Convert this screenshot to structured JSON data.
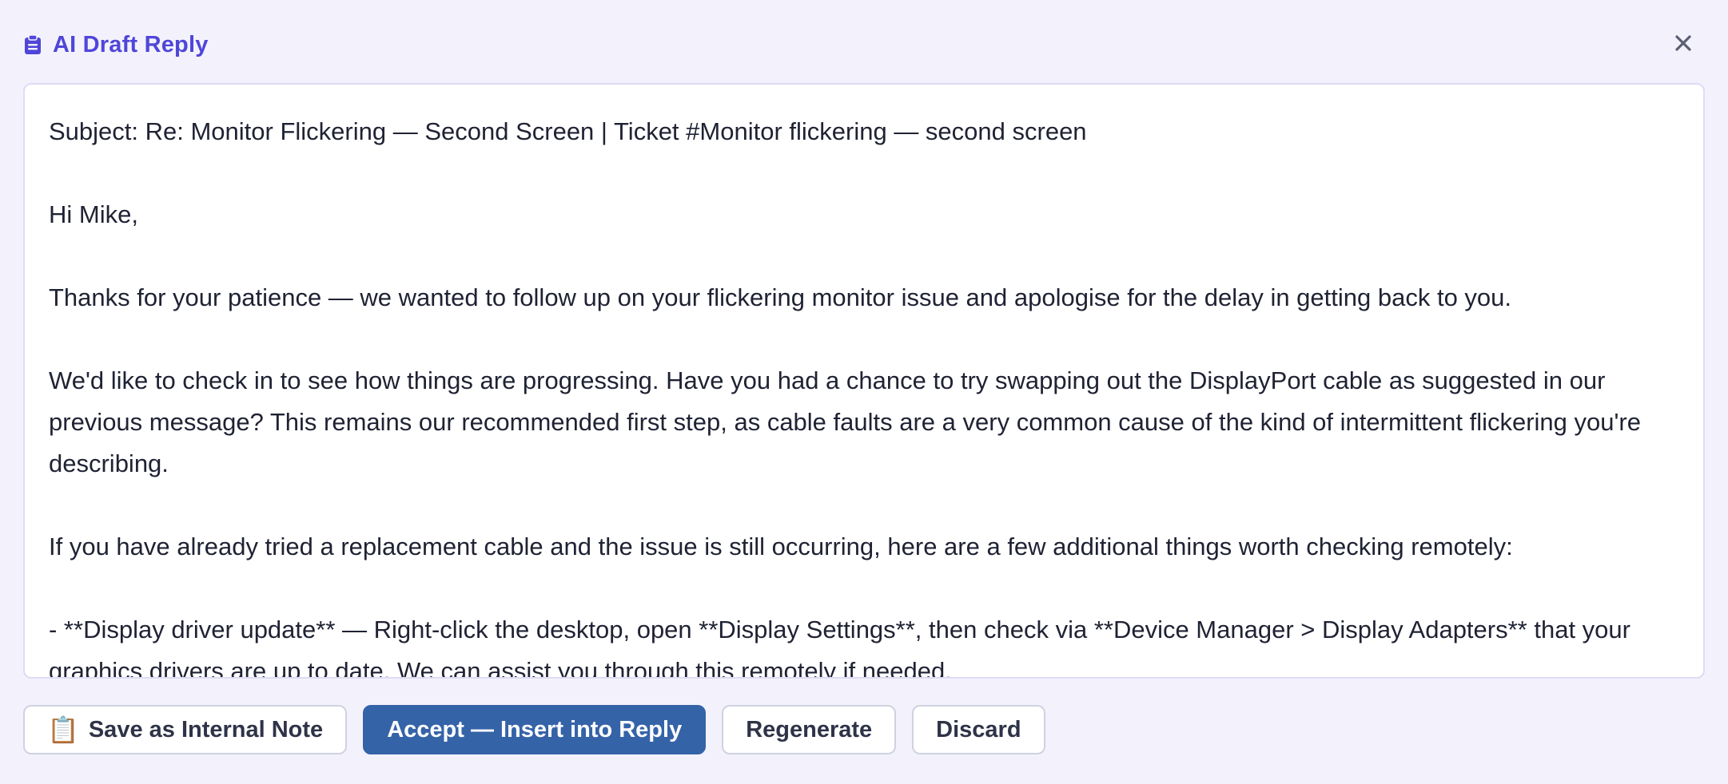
{
  "header": {
    "title": "AI Draft Reply",
    "icon": "clipboard-icon",
    "accent_color": "#4f46d8"
  },
  "close": {
    "icon": "close-icon",
    "symbol": "✕"
  },
  "draft": {
    "body": "Subject: Re: Monitor Flickering — Second Screen | Ticket #Monitor flickering — second screen\n\nHi Mike,\n\nThanks for your patience — we wanted to follow up on your flickering monitor issue and apologise for the delay in getting back to you.\n\nWe'd like to check in to see how things are progressing. Have you had a chance to try swapping out the DisplayPort cable as suggested in our previous message? This remains our recommended first step, as cable faults are a very common cause of the kind of intermittent flickering you're describing.\n\nIf you have already tried a replacement cable and the issue is still occurring, here are a few additional things worth checking remotely:\n\n- **Display driver update** — Right-click the desktop, open **Display Settings**, then check via **Device Manager > Display Adapters** that your graphics drivers are up to date. We can assist you through this remotely if needed."
  },
  "actions": {
    "save_note_emoji": "📋",
    "save_note_label": "Save as Internal Note",
    "accept_label": "Accept — Insert into Reply",
    "regenerate_label": "Regenerate",
    "discard_label": "Discard",
    "primary_color": "#3563a8"
  }
}
